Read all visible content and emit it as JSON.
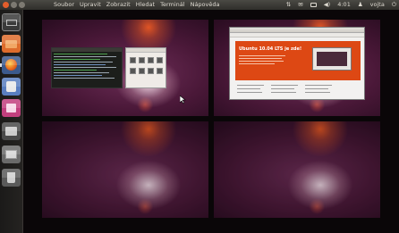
{
  "topbar": {
    "menus": [
      "Soubor",
      "Upravit",
      "Zobrazit",
      "Hledat",
      "Terminál",
      "Nápověda"
    ],
    "time": "4:01",
    "user": "vojta"
  },
  "launcher": {
    "items": [
      {
        "name": "workspaces-launcher-icon",
        "color": "#3a3a3a"
      },
      {
        "name": "home-folder-icon",
        "color": "#dd6c2c"
      },
      {
        "name": "firefox-icon",
        "color": "#e07a2a"
      },
      {
        "name": "software-center-icon",
        "color": "#5a7ec0"
      },
      {
        "name": "ubuntu-one-icon",
        "color": "#c23f7e"
      },
      {
        "name": "update-manager-icon",
        "color": "#606060"
      },
      {
        "name": "workspace-switcher-icon",
        "color": "#777"
      },
      {
        "name": "trash-icon",
        "color": "#666"
      }
    ]
  },
  "browser_page": {
    "headline": "Ubuntu 10.04 LTS je zde!"
  },
  "workspaces": [
    "workspace-1",
    "workspace-2",
    "workspace-3",
    "workspace-4"
  ]
}
